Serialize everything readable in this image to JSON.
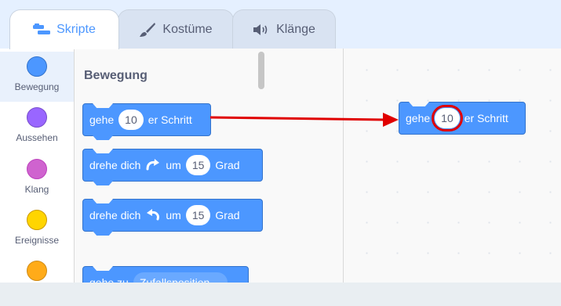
{
  "tabs": [
    {
      "label": "Skripte",
      "icon": "code-icon"
    },
    {
      "label": "Kostüme",
      "icon": "brush-icon"
    },
    {
      "label": "Klänge",
      "icon": "speaker-icon"
    }
  ],
  "categories": [
    {
      "label": "Bewegung",
      "color": "#4c97ff"
    },
    {
      "label": "Aussehen",
      "color": "#9966ff"
    },
    {
      "label": "Klang",
      "color": "#cf63cf"
    },
    {
      "label": "Ereignisse",
      "color": "#ffd500"
    },
    {
      "label": "",
      "color": "#ffab19"
    }
  ],
  "palette": {
    "title": "Bewegung",
    "blocks": [
      {
        "prefix": "gehe",
        "value": "10",
        "suffix": "er Schritt"
      },
      {
        "prefix": "drehe dich",
        "icon": "rotate-right-icon",
        "mid": "um",
        "value": "15",
        "suffix": "Grad"
      },
      {
        "prefix": "drehe dich",
        "icon": "rotate-left-icon",
        "mid": "um",
        "value": "15",
        "suffix": "Grad"
      },
      {
        "prefix": "gehe zu",
        "value": "Zufallsposition"
      }
    ]
  },
  "workspace": {
    "block": {
      "prefix": "gehe",
      "value": "10",
      "suffix": "er Schritt"
    },
    "highlight_color": "#e00000",
    "arrow_color": "#e00000"
  },
  "colors": {
    "motion": "#4c97ff",
    "accent": "#4c97ff"
  }
}
